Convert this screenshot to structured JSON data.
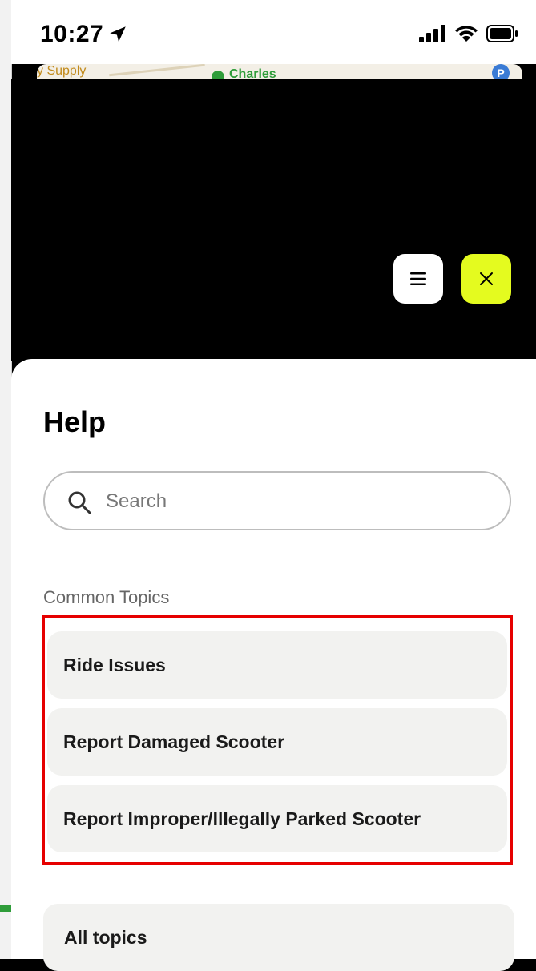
{
  "status_bar": {
    "time": "10:27",
    "icons": [
      "location-arrow-icon",
      "cellular-signal-icon",
      "wifi-icon",
      "battery-icon"
    ]
  },
  "map": {
    "labels": {
      "store": "y Supply",
      "place": "Charles",
      "parking": "P"
    }
  },
  "map_controls": {
    "menu_icon": "menu-icon",
    "close_icon": "close-icon",
    "close_color": "#e4fb1f"
  },
  "help_sheet": {
    "title": "Help",
    "search": {
      "placeholder": "Search",
      "value": ""
    },
    "common_topics_label": "Common Topics",
    "common_topics": [
      {
        "label": "Ride Issues"
      },
      {
        "label": "Report Damaged Scooter"
      },
      {
        "label": "Report Improper/Illegally Parked Scooter"
      }
    ],
    "all_topics_label": "All topics",
    "highlight_color": "#e60000"
  }
}
